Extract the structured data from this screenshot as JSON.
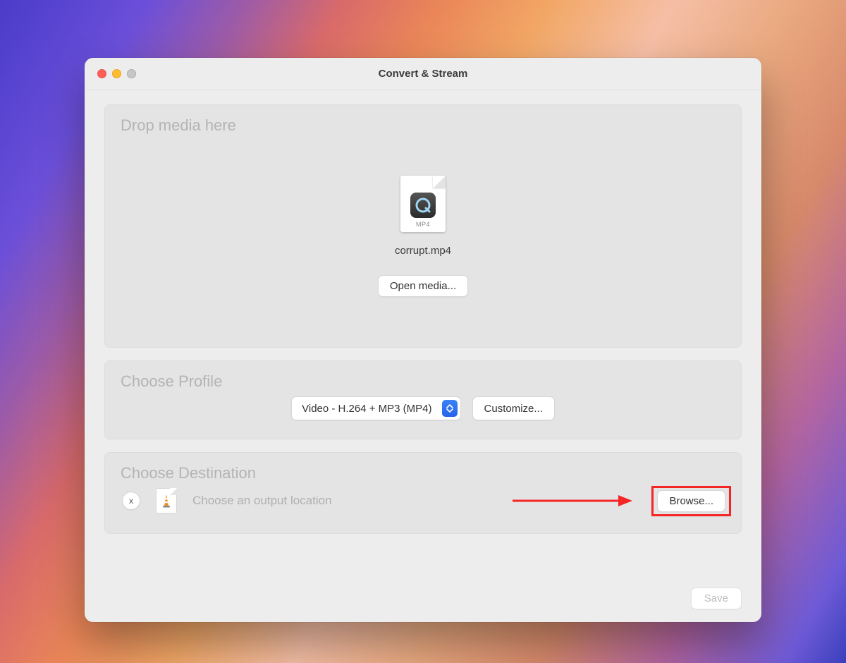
{
  "window": {
    "title": "Convert & Stream"
  },
  "drop": {
    "title": "Drop media here",
    "file_ext": "MP4",
    "file_name": "corrupt.mp4",
    "open_button": "Open media..."
  },
  "profile": {
    "title": "Choose Profile",
    "selected": "Video - H.264 + MP3 (MP4)",
    "customize_button": "Customize..."
  },
  "destination": {
    "title": "Choose Destination",
    "clear_label": "x",
    "placeholder": "Choose an output location",
    "browse_button": "Browse..."
  },
  "footer": {
    "save_button": "Save"
  }
}
